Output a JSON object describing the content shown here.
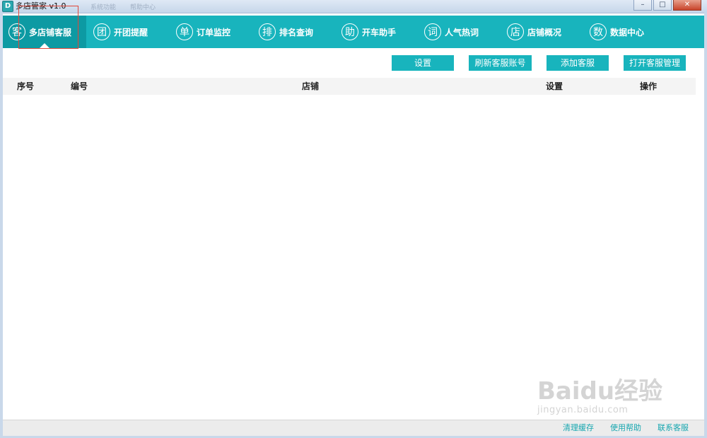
{
  "window": {
    "title": "多店管家 v1.0",
    "app_icon": "D",
    "ghost_menu": [
      "系统功能",
      "帮助中心"
    ],
    "controls": {
      "minimize": "–",
      "maximize": "□",
      "close": "✕"
    }
  },
  "nav": {
    "items": [
      {
        "icon_char": "客",
        "label": "多店铺客服",
        "active": true
      },
      {
        "icon_char": "团",
        "label": "开团提醒"
      },
      {
        "icon_char": "单",
        "label": "订单监控"
      },
      {
        "icon_char": "排",
        "label": "排名查询"
      },
      {
        "icon_char": "助",
        "label": "开车助手"
      },
      {
        "icon_char": "词",
        "label": "人气热词"
      },
      {
        "icon_char": "店",
        "label": "店铺概况"
      },
      {
        "icon_char": "数",
        "label": "数据中心"
      }
    ]
  },
  "toolbar": {
    "settings": "设置",
    "refresh_accounts": "刷新客服账号",
    "add_service": "添加客服",
    "open_management": "打开客服管理"
  },
  "table": {
    "columns": [
      "序号",
      "编号",
      "店铺",
      "设置",
      "操作"
    ],
    "rows": []
  },
  "statusbar": {
    "clear_cache": "清理缓存",
    "help": "使用帮助",
    "contact": "联系客服"
  },
  "watermark": {
    "brand": "Baidu经验",
    "url": "jingyan.baidu.com"
  },
  "colors": {
    "accent": "#18b4bd",
    "accent_dark": "#0d9aa3",
    "highlight": "#e0483a"
  }
}
